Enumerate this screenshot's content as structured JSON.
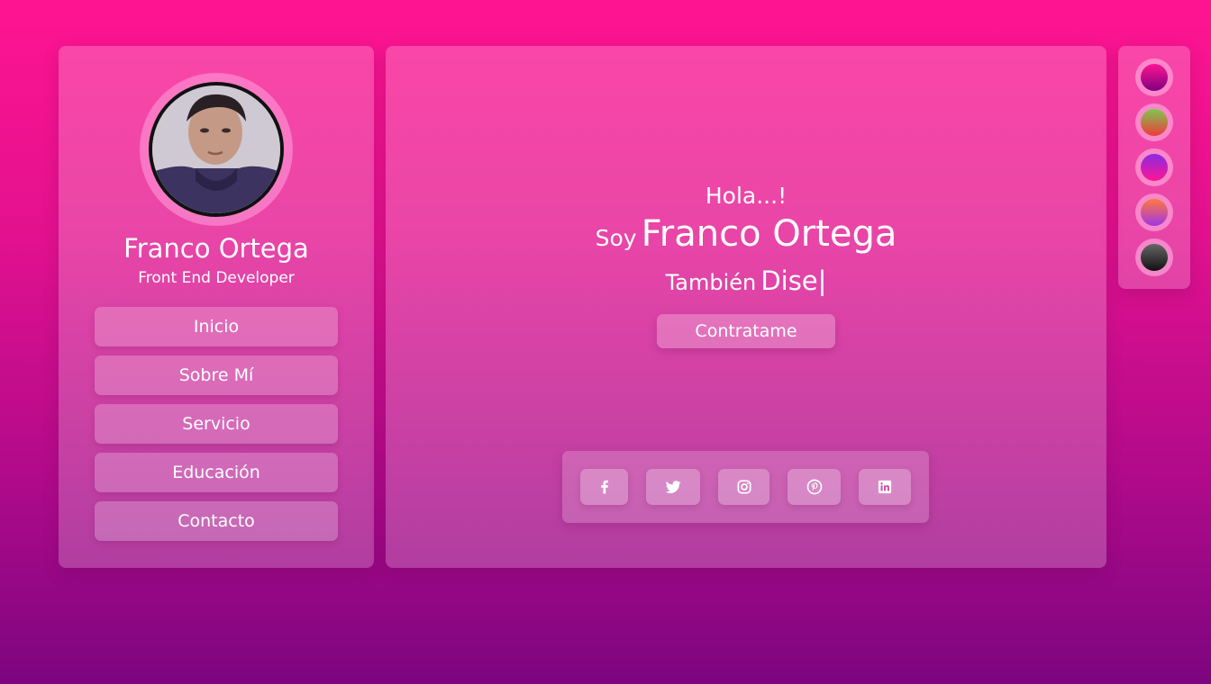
{
  "profile": {
    "name": "Franco Ortega",
    "role": "Front End Developer"
  },
  "nav": {
    "items": [
      {
        "label": "Inicio"
      },
      {
        "label": "Sobre Mí"
      },
      {
        "label": "Servicio"
      },
      {
        "label": "Educación"
      },
      {
        "label": "Contacto"
      }
    ]
  },
  "hero": {
    "greeting": "Hola...!",
    "soy": "Soy",
    "name": "Franco Ortega",
    "also": "También",
    "typed": "Dise|",
    "hire_label": "Contratame"
  },
  "social": {
    "icons": [
      "facebook-icon",
      "twitter-icon",
      "instagram-icon",
      "pinterest-icon",
      "linkedin-icon"
    ]
  },
  "themes": {
    "swatches": [
      {
        "from": "#ff1493",
        "to": "#800080"
      },
      {
        "from": "#7ec850",
        "to": "#f03a3a"
      },
      {
        "from": "#8a2be2",
        "to": "#ff1493"
      },
      {
        "from": "#ff7a3d",
        "to": "#a034e6"
      },
      {
        "from": "#666666",
        "to": "#111111"
      }
    ]
  },
  "colors": {
    "accent": "#ff1490",
    "background_bottom": "#7d0580",
    "text": "#ffffff"
  }
}
